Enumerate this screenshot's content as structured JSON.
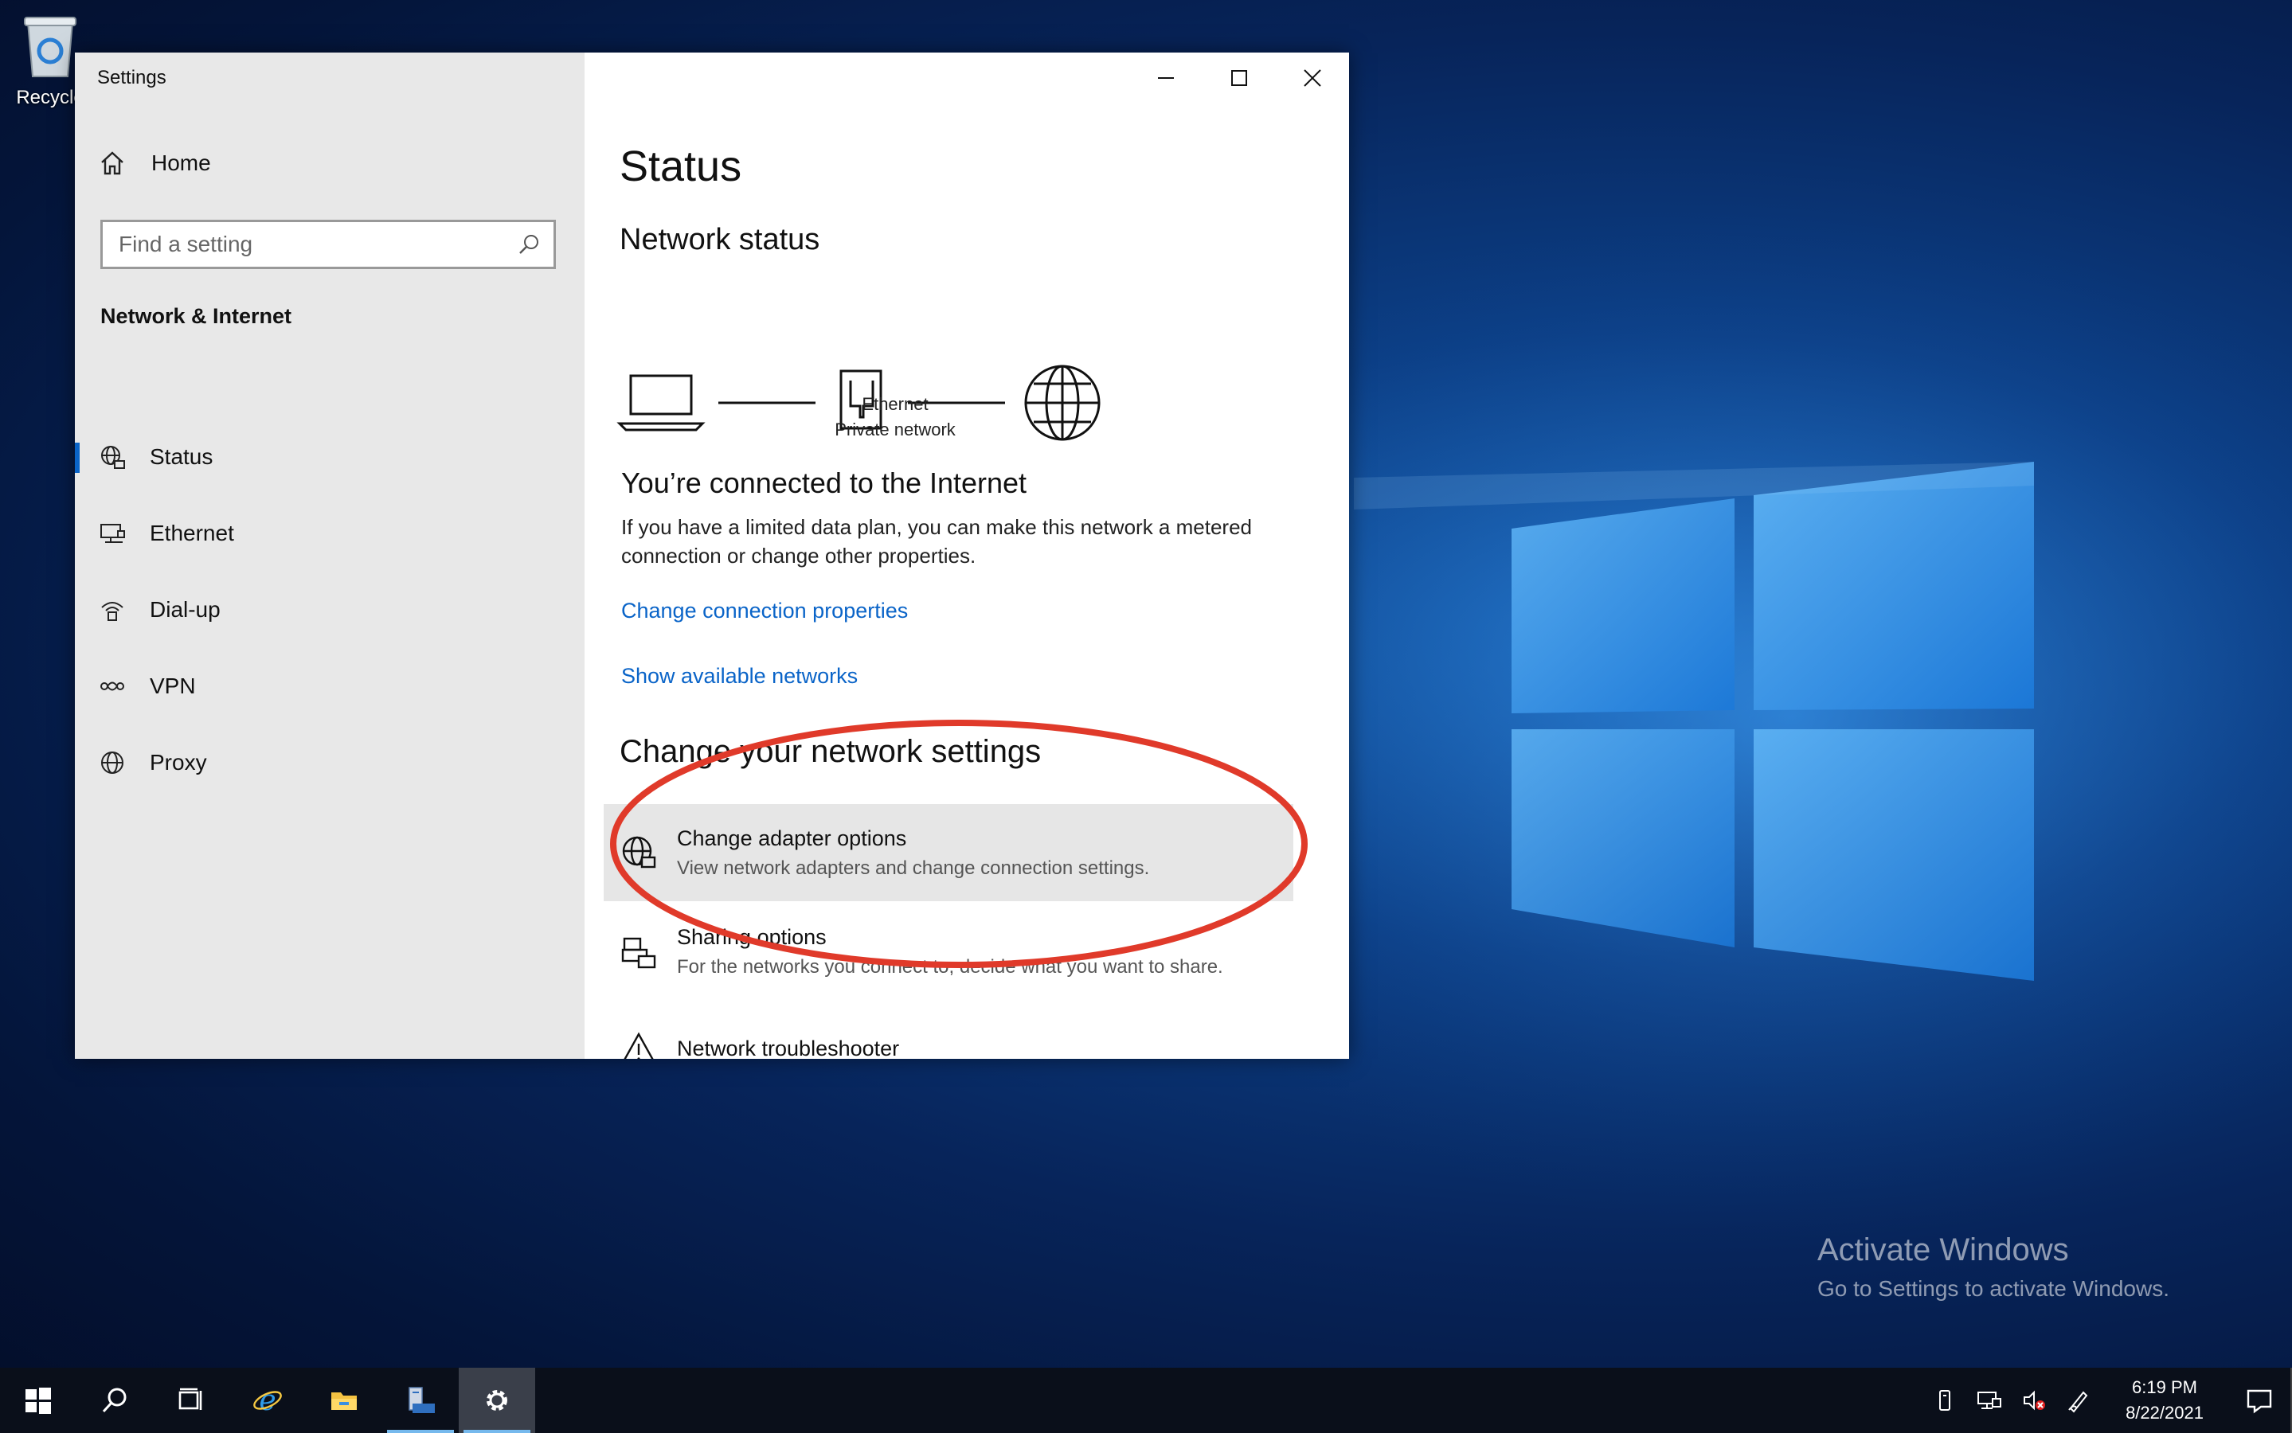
{
  "desktop": {
    "recycle_bin_label": "Recycle",
    "watermark": {
      "line1": "Activate Windows",
      "line2": "Go to Settings to activate Windows."
    }
  },
  "window": {
    "title": "Settings",
    "controls": [
      "minimize-icon",
      "maximize-icon",
      "close-icon"
    ]
  },
  "sidebar": {
    "home_label": "Home",
    "search": {
      "placeholder": "Find a setting",
      "value": ""
    },
    "section_title": "Network & Internet",
    "items": [
      {
        "label": "Status",
        "icon": "network-status-icon",
        "active": true
      },
      {
        "label": "Ethernet",
        "icon": "ethernet-icon",
        "active": false
      },
      {
        "label": "Dial-up",
        "icon": "dial-up-icon",
        "active": false
      },
      {
        "label": "VPN",
        "icon": "vpn-icon",
        "active": false
      },
      {
        "label": "Proxy",
        "icon": "globe-icon",
        "active": false
      }
    ]
  },
  "main": {
    "page_title": "Status",
    "network_status_title": "Network status",
    "diagram": {
      "connection_name": "Ethernet",
      "network_type": "Private network"
    },
    "connected_title": "You’re connected to the Internet",
    "connected_desc": "If you have a limited data plan, you can make this network a metered connection or change other properties.",
    "link_change_props": "Change connection properties",
    "link_show_networks": "Show available networks",
    "change_settings_title": "Change your network settings",
    "options": [
      {
        "title": "Change adapter options",
        "desc": "View network adapters and change connection settings.",
        "icon": "adapter-globe-icon"
      },
      {
        "title": "Sharing options",
        "desc": "For the networks you connect to, decide what you want to share.",
        "icon": "sharing-icon"
      },
      {
        "title": "Network troubleshooter",
        "desc": "",
        "icon": "warning-icon"
      }
    ]
  },
  "taskbar": {
    "buttons": [
      "windows-start-icon",
      "search-icon",
      "task-view-icon",
      "internet-explorer-icon",
      "file-explorer-icon",
      "server-manager-icon",
      "settings-gear-icon"
    ],
    "clock_time": "6:19 PM",
    "clock_date": "8/22/2021",
    "colors": {
      "taskbar": "#0a0f1a",
      "accent": "#0a64c8",
      "annotation": "#e03a2a"
    }
  }
}
